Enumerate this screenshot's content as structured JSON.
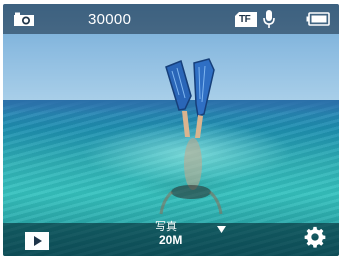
{
  "status_bar": {
    "mode_icon": "photo-mode-icon",
    "shot_count": "30000",
    "storage_icon": "tf-card-icon",
    "storage_label": "TF",
    "mic_icon": "microphone-icon",
    "battery_icon": "battery-icon",
    "battery_level": 1.0
  },
  "controls": {
    "playback_icon": "play-icon",
    "mode_label": "写真",
    "resolution": "20M",
    "dropdown_icon": "dropdown-arrow-icon",
    "settings_icon": "gear-icon"
  },
  "colors": {
    "overlay": "#14283c",
    "icon": "#ffffff"
  }
}
